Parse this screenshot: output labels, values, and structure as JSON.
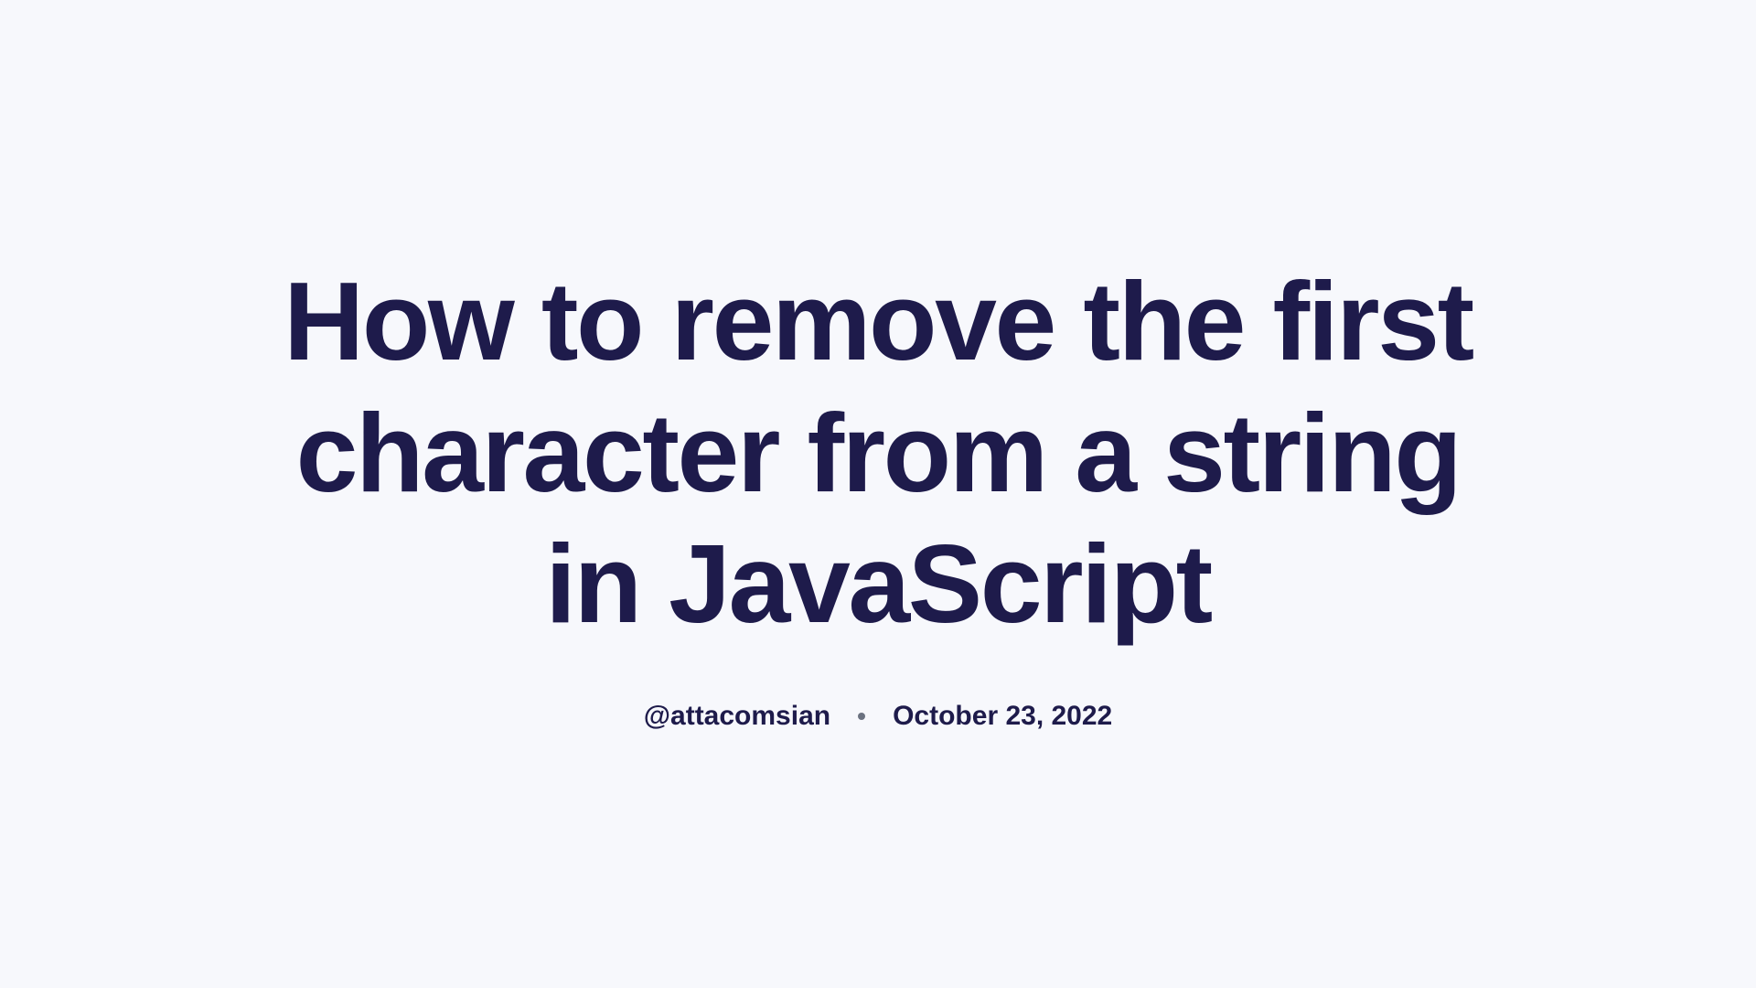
{
  "title": "How to remove the first character from a string in JavaScript",
  "author": "@attacomsian",
  "date": "October 23, 2022"
}
